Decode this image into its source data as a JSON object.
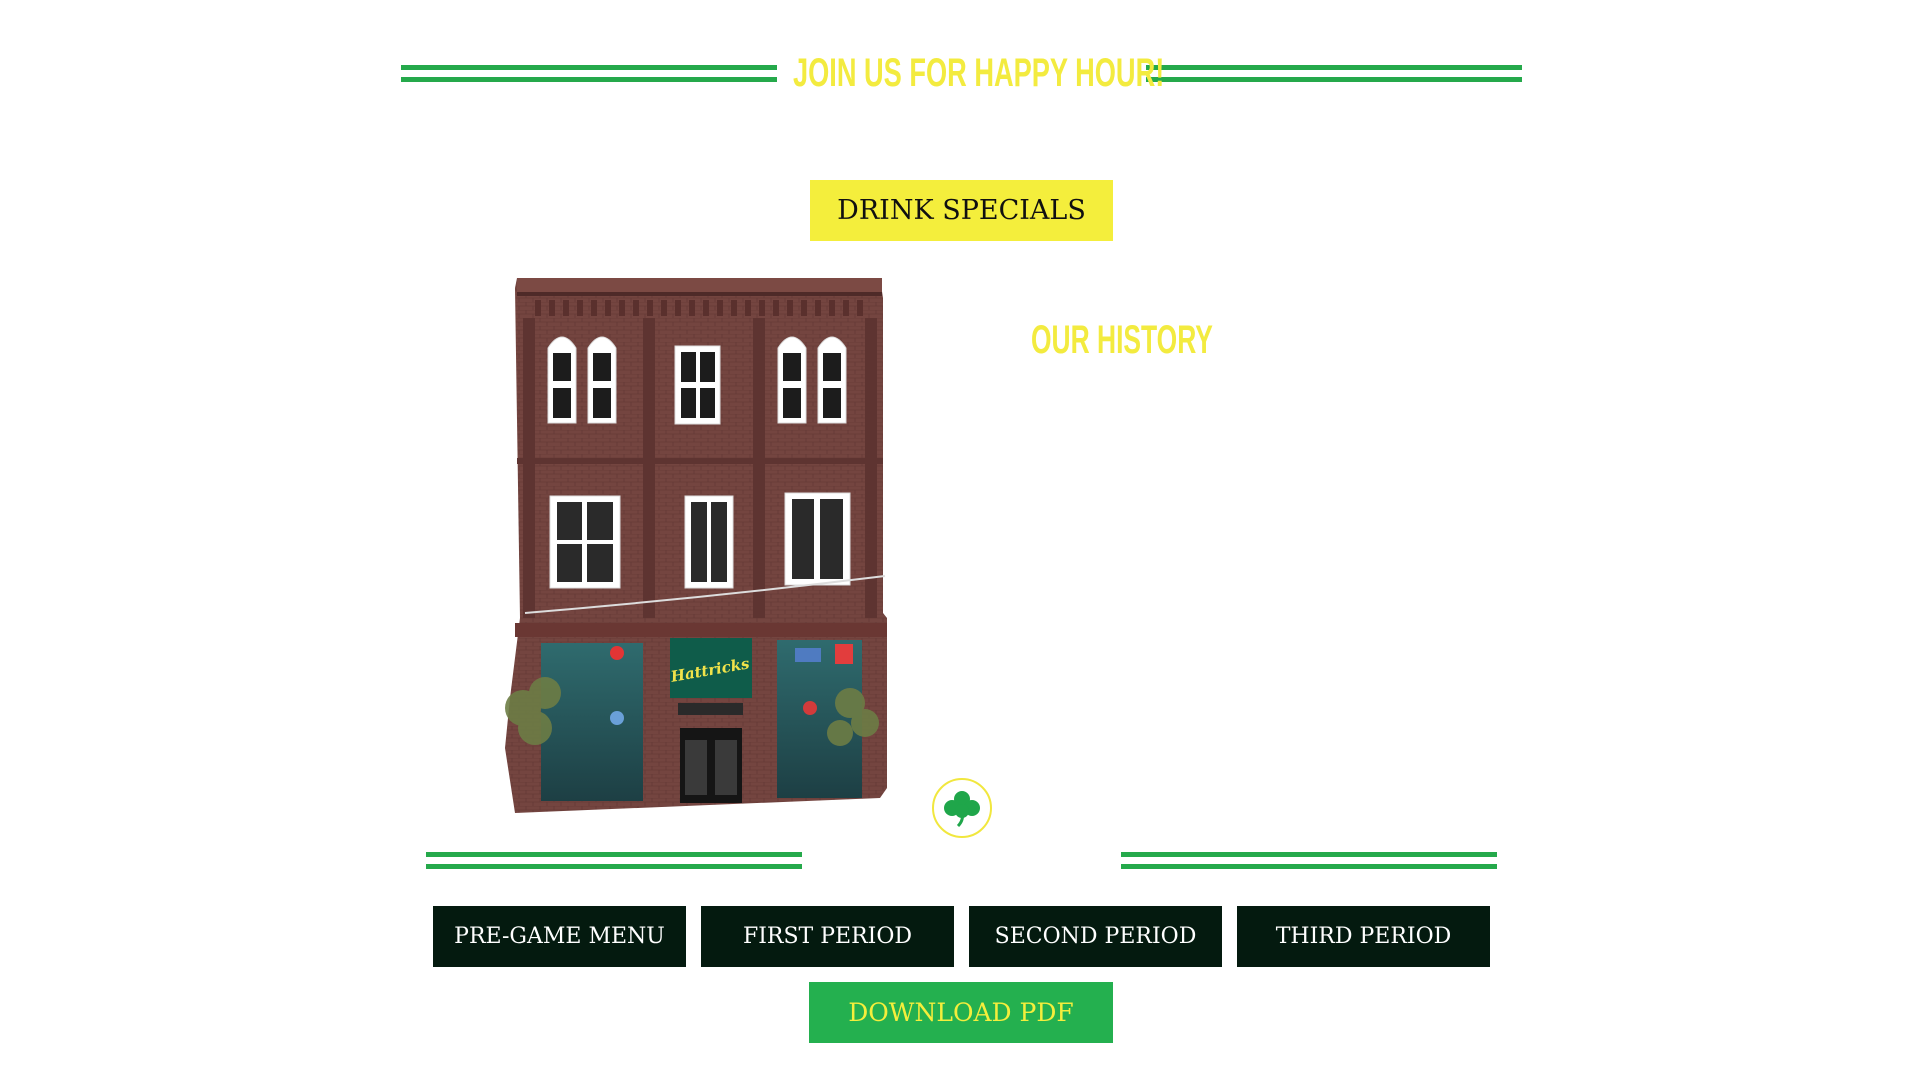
{
  "happy_hour": {
    "title": "JOIN US FOR HAPPY HOUR!",
    "drink_specials_label": "DRINK SPECIALS"
  },
  "history": {
    "title": "OUR HISTORY",
    "building_sign": "Hattricks"
  },
  "menu": {
    "tabs": [
      {
        "label": "PRE-GAME MENU"
      },
      {
        "label": "FIRST PERIOD"
      },
      {
        "label": "SECOND PERIOD"
      },
      {
        "label": "THIRD PERIOD"
      }
    ],
    "download_label": "DOWNLOAD PDF"
  },
  "colors": {
    "accent_yellow": "#f4ee3c",
    "accent_green": "#25a94b",
    "button_dark": "#041a0f",
    "brick": "#6e3f3a"
  },
  "icons": {
    "divider_icon": "shamrock-icon"
  }
}
